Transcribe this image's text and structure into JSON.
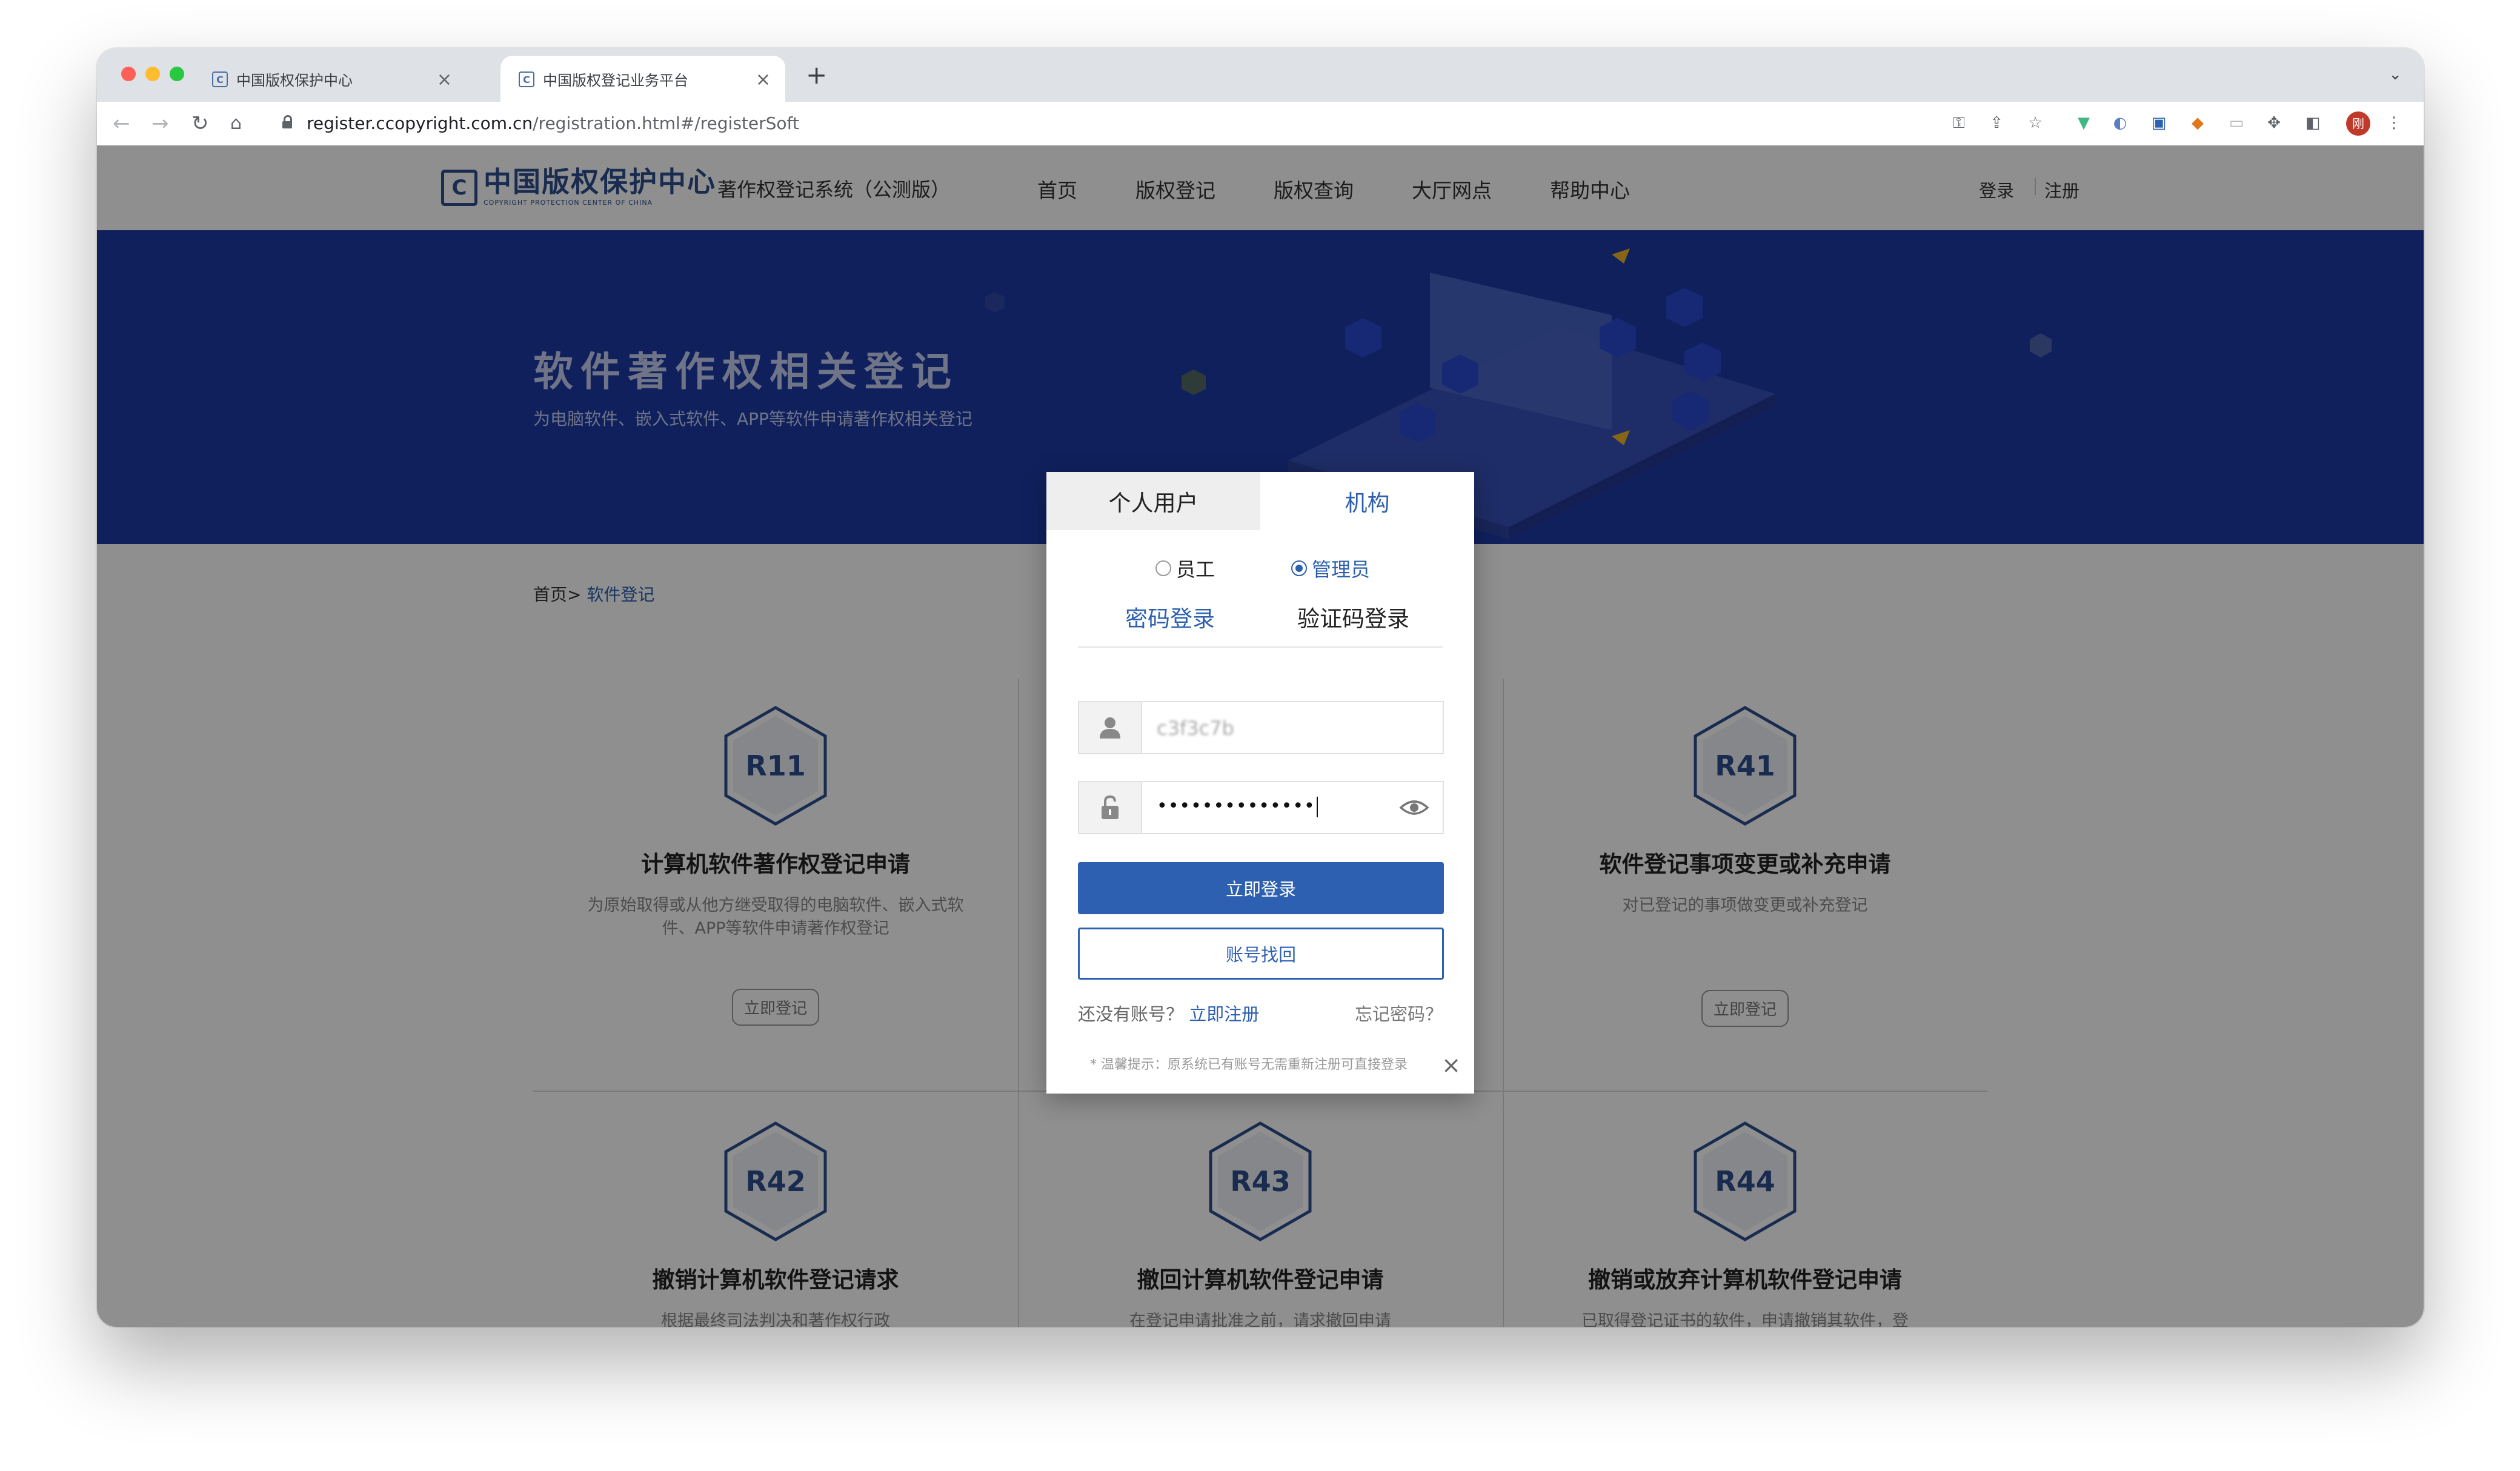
{
  "browser": {
    "tabs": [
      {
        "title": "中国版权保护中心",
        "favicon": "C"
      },
      {
        "title": "中国版权登记业务平台",
        "favicon": "C"
      }
    ],
    "url_host": "register.ccopyright.com.cn",
    "url_path": "/registration.html#/registerSoft",
    "profile_initial": "刚"
  },
  "site": {
    "logo_text": "中国版权保护中心",
    "logo_mark": "C",
    "logo_sub": "COPYRIGHT PROTECTION CENTER OF CHINA",
    "system_name": "著作权登记系统（公测版）",
    "nav": [
      "首页",
      "版权登记",
      "版权查询",
      "大厅网点",
      "帮助中心"
    ],
    "login": "登录",
    "register": "注册"
  },
  "banner": {
    "title": "软件著作权相关登记",
    "subtitle": "为电脑软件、嵌入式软件、APP等软件申请著作权相关登记"
  },
  "breadcrumb": {
    "home": "首页>",
    "current": "软件登记"
  },
  "cards": [
    {
      "code": "R11",
      "title": "计算机软件著作权登记申请",
      "desc": "为原始取得或从他方继受取得的电脑软件、嵌入式软件、APP等软件申请著作权登记",
      "button": "立即登记"
    },
    {
      "code": "R41",
      "title": "软件登记事项变更或补充申请",
      "desc": "对已登记的事项做变更或补充登记",
      "button": "立即登记"
    },
    {
      "code": "R42",
      "title": "撤销计算机软件登记请求",
      "desc": "根据最终司法判决和著作权行政"
    },
    {
      "code": "R43",
      "title": "撤回计算机软件登记申请",
      "desc": "在登记申请批准之前，请求撤回申请"
    },
    {
      "code": "R44",
      "title": "撤销或放弃计算机软件登记申请",
      "desc": "已取得登记证书的软件，申请撤销其软件，登"
    }
  ],
  "modal": {
    "tab_personal": "个人用户",
    "tab_org": "机构",
    "radio_employee": "员工",
    "radio_admin": "管理员",
    "selected_role": "管理员",
    "mode_password": "密码登录",
    "mode_code": "验证码登录",
    "username_value": "c3f3c7b",
    "password_value": "••••••••••••••",
    "login_button": "立即登录",
    "recover_button": "账号找回",
    "no_account": "还没有账号？",
    "register_now": "立即注册",
    "forgot": "忘记密码？",
    "tip": "* 温馨提示：原系统已有账号无需重新注册可直接登录"
  },
  "colors": {
    "primary": "#2d60b0",
    "banner": "#1b3aa6",
    "brand_dark": "#2d4f8f"
  }
}
